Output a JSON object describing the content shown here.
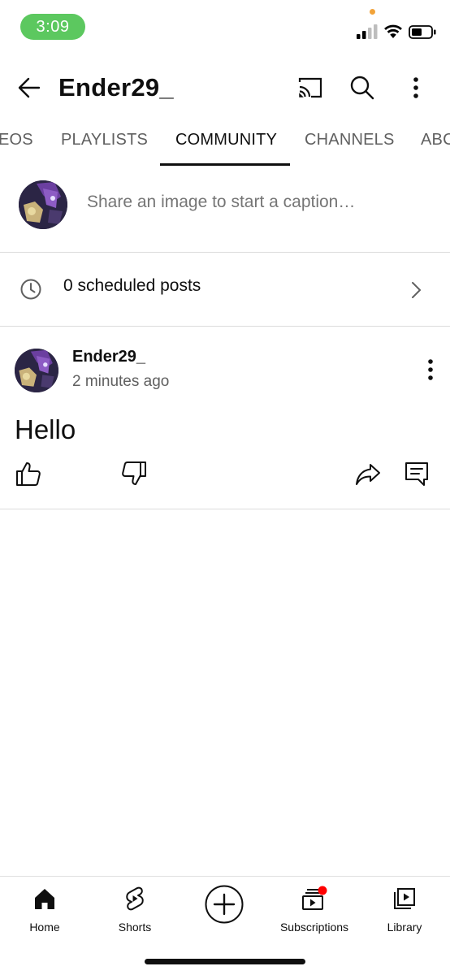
{
  "status_bar": {
    "time": "3:09"
  },
  "header": {
    "channel_title": "Ender29_"
  },
  "tabs": [
    {
      "label": "EOS",
      "active": false
    },
    {
      "label": "PLAYLISTS",
      "active": false
    },
    {
      "label": "COMMUNITY",
      "active": true
    },
    {
      "label": "CHANNELS",
      "active": false
    },
    {
      "label": "ABC",
      "active": false
    }
  ],
  "composer": {
    "placeholder": "Share an image to start a caption…"
  },
  "scheduled": {
    "label": "0 scheduled posts"
  },
  "post": {
    "author": "Ender29_",
    "time": "2 minutes ago",
    "text": "Hello"
  },
  "bottom_nav": [
    {
      "label": "Home",
      "icon": "home-icon"
    },
    {
      "label": "Shorts",
      "icon": "shorts-icon"
    },
    {
      "label": "Subscriptions",
      "icon": "subscriptions-icon"
    },
    {
      "label": "Library",
      "icon": "library-icon"
    }
  ],
  "colors": {
    "time_pill": "#5cc85f",
    "notification_dot": "#ff0000",
    "text_primary": "#0f0f0f",
    "text_secondary": "#606060"
  }
}
